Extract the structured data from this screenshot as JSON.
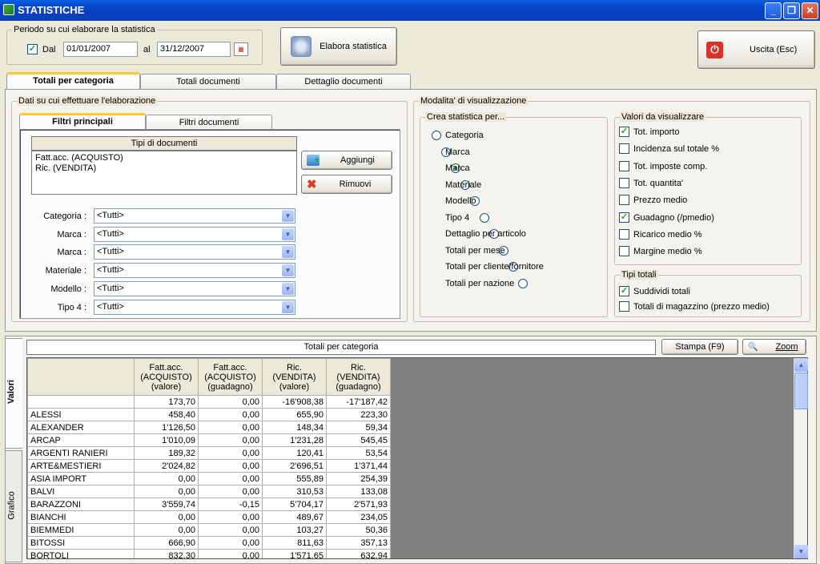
{
  "window": {
    "title": "STATISTICHE"
  },
  "period": {
    "group_label": "Periodo su cui elaborare la statistica",
    "dal_checked": true,
    "dal_label": "Dal",
    "from_date": "01/01/2007",
    "al_label": "al",
    "to_date": "31/12/2007"
  },
  "buttons": {
    "elabora": "Elabora statistica",
    "uscita": "Uscita (Esc)",
    "aggiungi": "Aggiungi",
    "rimuovi": "Rimuovi",
    "stampa": "Stampa (F9)",
    "zoom": "Zoom"
  },
  "main_tabs": [
    "Totali per categoria",
    "Totali documenti",
    "Dettaglio documenti"
  ],
  "data_group": {
    "label": "Dati su cui effettuare l'elaborazione",
    "sub_tabs": [
      "Filtri principali",
      "Filtri documenti"
    ],
    "doc_types_header": "Tipi di documenti",
    "doc_types": [
      "Fatt.acc. (ACQUISTO)",
      "Ric. (VENDITA)"
    ],
    "filters": [
      {
        "label": "Categoria :",
        "value": "<Tutti>"
      },
      {
        "label": "Marca :",
        "value": "<Tutti>"
      },
      {
        "label": "Marca :",
        "value": "<Tutti>"
      },
      {
        "label": "Materiale :",
        "value": "<Tutti>"
      },
      {
        "label": "Modello :",
        "value": "<Tutti>"
      },
      {
        "label": "Tipo 4 :",
        "value": "<Tutti>"
      }
    ]
  },
  "view_group": {
    "label": "Modalita' di visualizzazione",
    "crea_label": "Crea statistica per...",
    "crea_options": [
      "Categoria",
      "Marca",
      "Marca",
      "Materiale",
      "Modello",
      "Tipo 4",
      "Dettaglio per articolo",
      "Totali per mese",
      "Totali per cliente/fornitore",
      "Totali per nazione"
    ],
    "crea_selected": 2,
    "valori_label": "Valori da visualizzare",
    "valori": [
      {
        "label": "Tot. importo",
        "checked": true
      },
      {
        "label": "Incidenza sul totale %",
        "checked": false
      },
      {
        "label": "Tot. imposte comp.",
        "checked": false
      },
      {
        "label": "Tot. quantita'",
        "checked": false
      },
      {
        "label": "Prezzo medio",
        "checked": false
      },
      {
        "label": "Guadagno (/pmedio)",
        "checked": true
      },
      {
        "label": "Ricarico medio %",
        "checked": false
      },
      {
        "label": "Margine medio %",
        "checked": false
      }
    ],
    "tipi_label": "Tipi totali",
    "tipi": [
      {
        "label": "Suddividi totali",
        "checked": true
      },
      {
        "label": "Totali di magazzino (prezzo medio)",
        "checked": false
      }
    ]
  },
  "side_tabs": [
    "Valori",
    "Grafico"
  ],
  "grid": {
    "title": "Totali per categoria",
    "headers": [
      [
        "Fatt.acc.",
        "(ACQUISTO)",
        "(valore)"
      ],
      [
        "Fatt.acc.",
        "(ACQUISTO)",
        "(guadagno)"
      ],
      [
        "Ric.",
        "(VENDITA)",
        "(valore)"
      ],
      [
        "Ric.",
        "(VENDITA)",
        "(guadagno)"
      ]
    ],
    "rows": [
      [
        "",
        "173,70",
        "0,00",
        "-16'908,38",
        "-17'187,42"
      ],
      [
        "ALESSI",
        "458,40",
        "0,00",
        "655,90",
        "223,30"
      ],
      [
        "ALEXANDER",
        "1'126,50",
        "0,00",
        "148,34",
        "59,34"
      ],
      [
        "ARCAP",
        "1'010,09",
        "0,00",
        "1'231,28",
        "545,45"
      ],
      [
        "ARGENTI RANIERI",
        "189,32",
        "0,00",
        "120,41",
        "53,54"
      ],
      [
        "ARTE&MESTIERI",
        "2'024,82",
        "0,00",
        "2'696,51",
        "1'371,44"
      ],
      [
        "ASIA IMPORT",
        "0,00",
        "0,00",
        "555,89",
        "254,39"
      ],
      [
        "BALVI",
        "0,00",
        "0,00",
        "310,53",
        "133,08"
      ],
      [
        "BARAZZONI",
        "3'559,74",
        "-0,15",
        "5'704,17",
        "2'571,93"
      ],
      [
        "BIANCHI",
        "0,00",
        "0,00",
        "489,67",
        "234,05"
      ],
      [
        "BIEMMEDI",
        "0,00",
        "0,00",
        "103,27",
        "50,36"
      ],
      [
        "BITOSSI",
        "666,90",
        "0,00",
        "811,63",
        "357,13"
      ],
      [
        "BORTOLI",
        "832,30",
        "0,00",
        "1'571,65",
        "632,94"
      ]
    ]
  }
}
